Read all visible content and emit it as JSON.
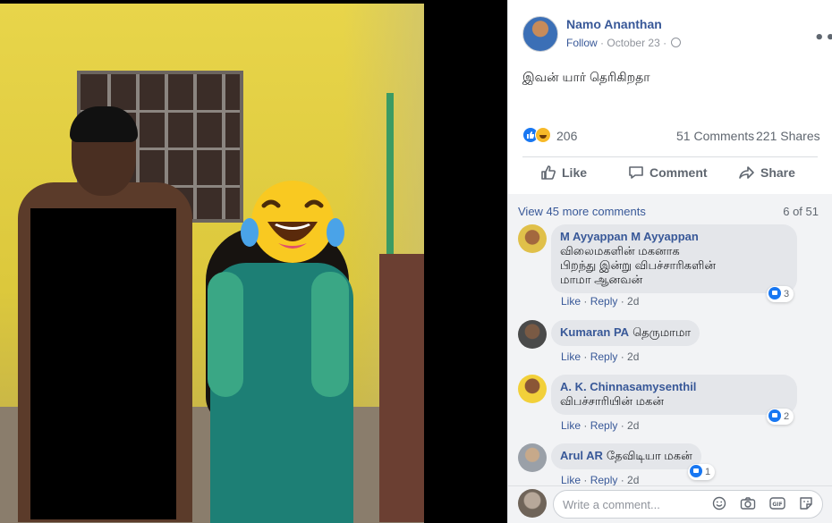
{
  "post": {
    "author": "Namo Ananthan",
    "follow_label": "Follow",
    "date": "October 23",
    "separator": "·",
    "more_label": "•••",
    "text": "இவன் யார் தெரிகிறதா",
    "reaction_count": "206",
    "comment_count": "51 Comments",
    "share_count": "221 Shares",
    "actions": {
      "like": "Like",
      "comment": "Comment",
      "share": "Share"
    }
  },
  "comments": {
    "view_more": "View 45 more comments",
    "pager": "6 of 51",
    "items": [
      {
        "name": "M Ayyappan M Ayyappan",
        "lines": [
          "விலைமகளின் மகனாக",
          "பிறந்து இன்று விபச்சாரிகளின்",
          "மாமா ஆனவன்"
        ],
        "like": "Like",
        "reply": "Reply",
        "age": "2d",
        "reactions": "3"
      },
      {
        "name": "Kumaran PA",
        "text": "தெருமாமா",
        "like": "Like",
        "reply": "Reply",
        "age": "2d"
      },
      {
        "name": "A. K. Chinnasamysenthil",
        "text": "விபச்சாரியின் மகன்",
        "like": "Like",
        "reply": "Reply",
        "age": "2d",
        "reactions": "2"
      },
      {
        "name": "Arul AR",
        "text": "தேவிடியா மகன்",
        "like": "Like",
        "reply": "Reply",
        "age": "2d",
        "reactions": "1"
      }
    ]
  },
  "write": {
    "placeholder": "Write a comment..."
  },
  "colors": {
    "link": "#385898",
    "accent": "#1877f2",
    "muted": "#606770",
    "bubble": "#e4e6ea"
  }
}
